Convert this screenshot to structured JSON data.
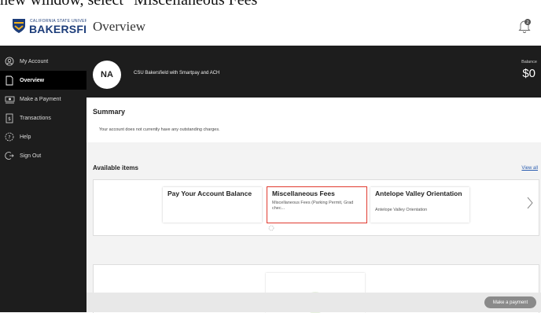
{
  "caption": "new window, select \"Miscellaneous Fees\"",
  "brand": {
    "small_text": "CALIFORNIA STATE UNIVERSITY",
    "name": "BAKERSFIELD"
  },
  "sidebar": {
    "items": [
      {
        "label": "My Account",
        "icon": "person-circle-icon"
      },
      {
        "label": "Overview",
        "icon": "document-icon"
      },
      {
        "label": "Make a Payment",
        "icon": "cash-icon"
      },
      {
        "label": "Transactions",
        "icon": "receipt-icon"
      },
      {
        "label": "Help",
        "icon": "question-icon"
      },
      {
        "label": "Sign Out",
        "icon": "sign-out-icon"
      }
    ]
  },
  "header": {
    "title": "Overview",
    "notification_count": "2"
  },
  "account": {
    "initials": "NA",
    "name": "CSU Bakersfield with Smartpay and ACH",
    "balance_label": "Balance",
    "balance_value": "$0"
  },
  "summary": {
    "title": "Summary",
    "text": "Your account does not currently have any outstanding charges."
  },
  "available": {
    "title": "Available items",
    "view_all": "View all",
    "cards": [
      {
        "title": "Pay Your Account Balance",
        "desc": ""
      },
      {
        "title": "Miscellaneous Fees",
        "desc": "Miscellaneous Fees (Parking Permit, Grad chec..."
      },
      {
        "title": "Antelope Valley Orientation",
        "desc": "Antelope Valley Orientation"
      }
    ]
  },
  "footer": {
    "pay_button": "Make a payment"
  },
  "colors": {
    "sidebar": "#1d1d1d",
    "highlight": "#e03a2f",
    "link": "#2a5db0"
  }
}
